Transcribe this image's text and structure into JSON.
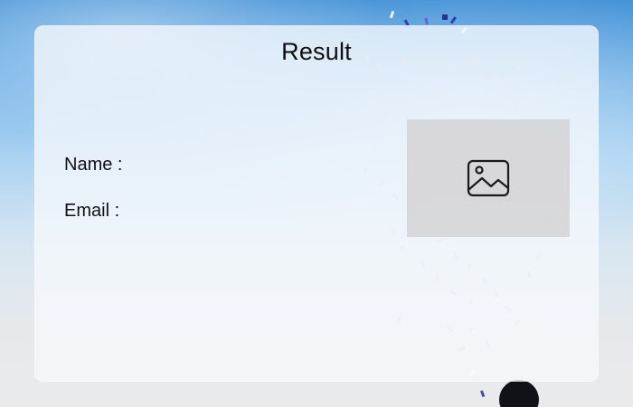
{
  "card": {
    "title": "Result"
  },
  "fields": {
    "name_label": "Name :",
    "name_value": "",
    "email_label": "Email :",
    "email_value": ""
  },
  "image": {
    "icon": "image-icon"
  },
  "colors": {
    "sky_top": "#3f8fd6",
    "card_background": "#f6f8fc",
    "placeholder": "#d6d6d8",
    "text": "#101114"
  }
}
